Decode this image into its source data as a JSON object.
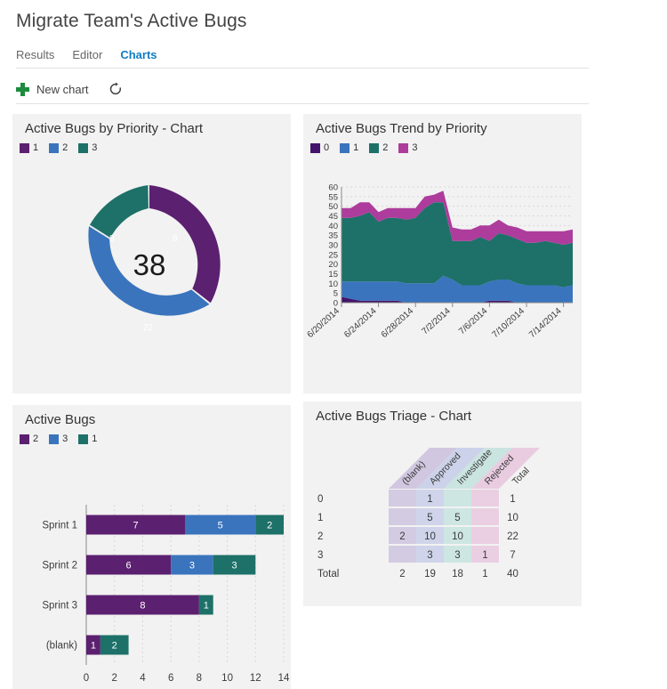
{
  "header": {
    "title": "Migrate Team's Active Bugs",
    "tabs": [
      {
        "label": "Results",
        "active": false
      },
      {
        "label": "Editor",
        "active": false
      },
      {
        "label": "Charts",
        "active": true
      }
    ],
    "toolbar": {
      "new_chart_label": "New chart",
      "new_chart_icon": "plus-icon",
      "refresh_icon": "refresh-icon"
    }
  },
  "colors": {
    "purple": "#5c2070",
    "blue": "#3a74bd",
    "teal": "#1d7168",
    "magenta": "#ad3c9c",
    "panel_bg": "#f2f2f2",
    "accent_link": "#0f7cc4",
    "plus_green": "#1d8b3f"
  },
  "panels": {
    "donut": {
      "title": "Active Bugs by Priority - Chart",
      "legend": [
        {
          "label": "1",
          "color": "#5c2070"
        },
        {
          "label": "2",
          "color": "#3a74bd"
        },
        {
          "label": "3",
          "color": "#1d7168"
        }
      ],
      "center_total": "38"
    },
    "trend": {
      "title": "Active Bugs Trend by Priority",
      "legend": [
        {
          "label": "0",
          "color": "#44136b"
        },
        {
          "label": "1",
          "color": "#3a74bd"
        },
        {
          "label": "2",
          "color": "#1d7168"
        },
        {
          "label": "3",
          "color": "#ad3c9c"
        }
      ]
    },
    "bars": {
      "title": "Active Bugs",
      "legend": [
        {
          "label": "2",
          "color": "#5c2070"
        },
        {
          "label": "3",
          "color": "#3a74bd"
        },
        {
          "label": "1",
          "color": "#1d7168"
        }
      ]
    },
    "triage": {
      "title": "Active Bugs Triage - Chart"
    }
  },
  "chart_data": [
    {
      "id": "active-bugs-by-priority",
      "type": "pie",
      "title": "Active Bugs by Priority - Chart",
      "donut": true,
      "center_label": "38",
      "total": 38,
      "categories": [
        "1",
        "2",
        "3"
      ],
      "values": [
        8,
        22,
        8
      ],
      "slice_labels": [
        "8",
        "22",
        "8"
      ],
      "colors": [
        "#5c2070",
        "#3a74bd",
        "#1d7168"
      ],
      "legend_position": "top-left"
    },
    {
      "id": "active-bugs-trend-by-priority",
      "type": "area",
      "stacked": true,
      "title": "Active Bugs Trend by Priority",
      "xlabel": "",
      "ylabel": "",
      "ylim": [
        0,
        60
      ],
      "yticks": [
        0,
        5,
        10,
        15,
        20,
        25,
        30,
        35,
        40,
        45,
        50,
        55,
        60
      ],
      "grid": true,
      "legend_position": "top-left",
      "x_tick_labels": [
        "6/20/2014",
        "6/24/2014",
        "6/28/2014",
        "7/2/2014",
        "7/6/2014",
        "7/10/2014",
        "7/14/2014"
      ],
      "x": [
        "6/20/2014",
        "6/21/2014",
        "6/22/2014",
        "6/23/2014",
        "6/24/2014",
        "6/25/2014",
        "6/26/2014",
        "6/27/2014",
        "6/28/2014",
        "6/29/2014",
        "6/30/2014",
        "7/1/2014",
        "7/2/2014",
        "7/3/2014",
        "7/4/2014",
        "7/5/2014",
        "7/6/2014",
        "7/7/2014",
        "7/8/2014",
        "7/9/2014",
        "7/10/2014",
        "7/11/2014",
        "7/12/2014",
        "7/13/2014",
        "7/14/2014",
        "7/15/2014"
      ],
      "series": [
        {
          "name": "0",
          "color": "#44136b",
          "values": [
            3,
            2,
            1,
            1,
            1,
            1,
            1,
            0,
            0,
            0,
            0,
            0,
            0,
            0,
            0,
            0,
            1,
            1,
            1,
            0,
            0,
            0,
            0,
            0,
            0,
            0
          ]
        },
        {
          "name": "1",
          "color": "#3a74bd",
          "values": [
            8,
            9,
            10,
            10,
            10,
            10,
            10,
            10,
            10,
            10,
            10,
            14,
            12,
            9,
            9,
            9,
            10,
            11,
            11,
            10,
            9,
            9,
            9,
            9,
            8,
            9
          ]
        },
        {
          "name": "2",
          "color": "#1d7168",
          "values": [
            33,
            33,
            34,
            36,
            31,
            33,
            33,
            33,
            34,
            39,
            42,
            38,
            20,
            23,
            23,
            25,
            21,
            24,
            23,
            23,
            22,
            22,
            23,
            22,
            22,
            22
          ]
        },
        {
          "name": "3",
          "color": "#ad3c9c",
          "values": [
            5,
            5,
            7,
            5,
            5,
            5,
            5,
            6,
            5,
            6,
            4,
            6,
            7,
            6,
            6,
            6,
            8,
            7,
            5,
            6,
            6,
            6,
            5,
            6,
            7,
            7
          ]
        }
      ]
    },
    {
      "id": "active-bugs",
      "type": "bar",
      "orientation": "horizontal",
      "stacked": true,
      "title": "Active Bugs",
      "categories": [
        "Sprint 1",
        "Sprint 2",
        "Sprint 3",
        "(blank)"
      ],
      "xticks": [
        0,
        2,
        4,
        6,
        8,
        10,
        12,
        14
      ],
      "xlim": [
        0,
        14
      ],
      "grid": true,
      "legend_position": "top-left",
      "series": [
        {
          "name": "2",
          "color": "#5c2070",
          "values": [
            7,
            6,
            8,
            1
          ]
        },
        {
          "name": "3",
          "color": "#3a74bd",
          "values": [
            5,
            3,
            0,
            0
          ]
        },
        {
          "name": "1",
          "color": "#1d7168",
          "values": [
            2,
            3,
            1,
            2
          ]
        }
      ]
    },
    {
      "id": "active-bugs-triage",
      "type": "table",
      "title": "Active Bugs Triage - Chart",
      "columns": [
        "",
        "(blank)",
        "Approved",
        "Investigate",
        "Rejected",
        "Total"
      ],
      "column_colors": [
        "",
        "#cbc0dd",
        "#c6cce8",
        "#c3e2dd",
        "#e7c6dd",
        ""
      ],
      "rows": [
        {
          "label": "0",
          "cells": [
            "",
            "1",
            "",
            ""
          ],
          "total": "1"
        },
        {
          "label": "1",
          "cells": [
            "",
            "5",
            "5",
            ""
          ],
          "total": "10"
        },
        {
          "label": "2",
          "cells": [
            "2",
            "10",
            "10",
            ""
          ],
          "total": "22"
        },
        {
          "label": "3",
          "cells": [
            "",
            "3",
            "3",
            "1"
          ],
          "total": "7"
        }
      ],
      "total_row": {
        "label": "Total",
        "cells": [
          "2",
          "19",
          "18",
          "1"
        ],
        "total": "40"
      }
    }
  ]
}
